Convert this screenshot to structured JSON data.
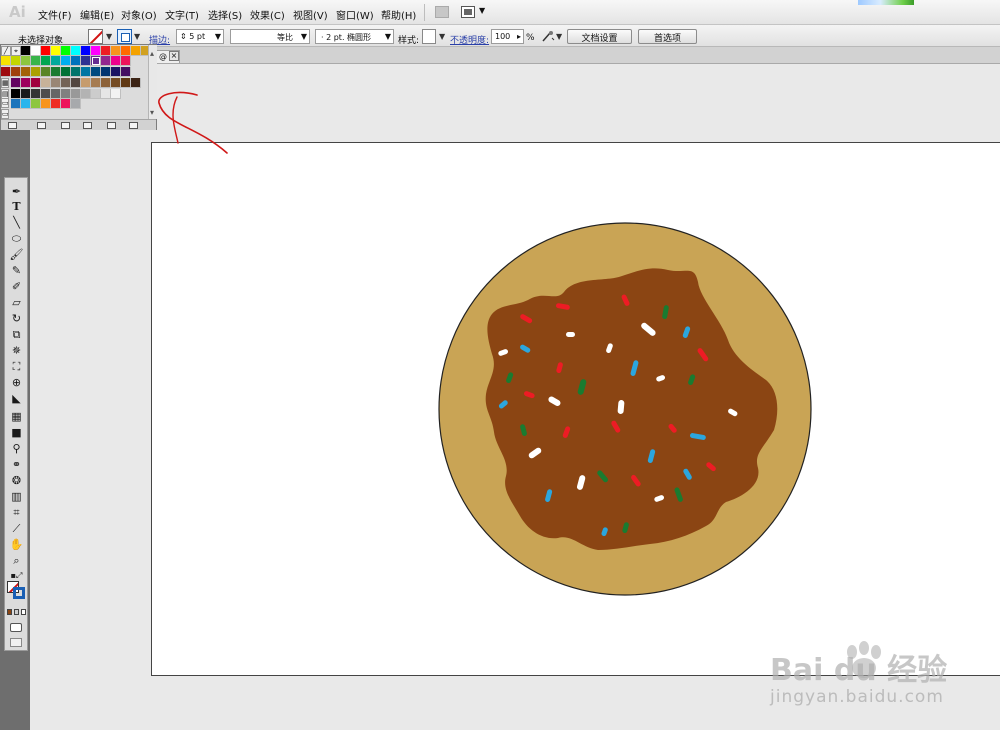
{
  "app": {
    "logo": "Ai"
  },
  "menubar": {
    "items": [
      "文件(F)",
      "编辑(E)",
      "对象(O)",
      "文字(T)",
      "选择(S)",
      "效果(C)",
      "视图(V)",
      "窗口(W)",
      "帮助(H)"
    ]
  },
  "control_bar": {
    "selection_status": "未选择对象",
    "stroke_label": "描边:",
    "stroke_weight": "5 pt",
    "profile": "等比",
    "brush": "2 pt. 椭圆形",
    "style_label": "样式:",
    "opacity_label": "不透明度:",
    "opacity_value": "100",
    "opacity_unit": "%",
    "doc_setup_button": "文档设置",
    "preferences_button": "首选项"
  },
  "document": {
    "tab_label": "@",
    "tab_close": "×"
  },
  "swatches": {
    "row1": [
      "#000000",
      "#ffffff",
      "#ff0000",
      "#ffff00",
      "#00ff00",
      "#00ffff",
      "#0000ff",
      "#ff00ff",
      "#ee1d24",
      "#f7941d",
      "#ff6b00",
      "#f4a200",
      "#d1a120"
    ],
    "row2": [
      "#f7e300",
      "#c3d600",
      "#8dc63f",
      "#39b54a",
      "#00a651",
      "#00a99d",
      "#00aeef",
      "#0072bc",
      "#2e3192",
      "#662d91",
      "#92278f",
      "#ec008c",
      "#ed145b"
    ],
    "row3": [
      "#9e0b0f",
      "#a0410d",
      "#a36209",
      "#aba000",
      "#598527",
      "#1a7b30",
      "#007236",
      "#00746b",
      "#0076a3",
      "#004a80",
      "#003471",
      "#1b1464",
      "#440e62"
    ],
    "row4": [
      "#630460",
      "#9e005d",
      "#a0003e",
      "#c7b299",
      "#998675",
      "#736357",
      "#534741",
      "#c69c6d",
      "#a67c52",
      "#8c6239",
      "#754c24",
      "#603813",
      "#3c2415"
    ],
    "grays": [
      "#000000",
      "#1a1a1a",
      "#333333",
      "#4d4d4d",
      "#666666",
      "#808080",
      "#999999",
      "#b3b3b3",
      "#cccccc",
      "#e6e6e6",
      "#f2f2f2"
    ],
    "brights": [
      "#1c75bc",
      "#2bb5ec",
      "#8dc63f",
      "#f7941d",
      "#ee2d24",
      "#ed145b",
      "#a7a9ac"
    ]
  },
  "artwork": {
    "plate_color": "#c9a455",
    "frosting_color": "#8b4513",
    "sprinkle_colors": [
      "#ed1c24",
      "#ffffff",
      "#1e9bd7",
      "#1a7b30"
    ]
  },
  "watermark": {
    "brand": "Bai du 经验",
    "url": "jingyan.baidu.com"
  }
}
